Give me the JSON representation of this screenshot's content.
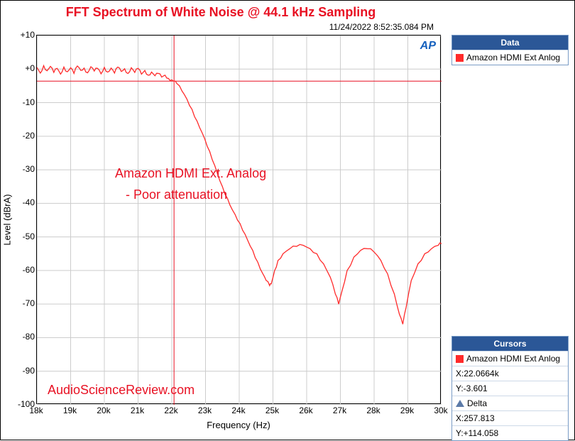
{
  "title": "FFT Spectrum of White Noise @ 44.1 kHz Sampling",
  "timestamp": "11/24/2022 8:52:35.084 PM",
  "logo": "AP",
  "xlabel": "Frequency (Hz)",
  "ylabel": "Level (dBrA)",
  "annotation_line1": "Amazon HDMI Ext. Analog",
  "annotation_line2": "- Poor attenuation",
  "watermark": "AudioScienceReview.com",
  "legend": {
    "header": "Data",
    "series_name": "Amazon HDMI Ext Anlog"
  },
  "cursors": {
    "header": "Cursors",
    "series_name": "Amazon HDMI Ext Anlog",
    "x_label": "X:22.0664k",
    "y_label": "Y:-3.601",
    "delta_label": "Delta",
    "delta_x": "X:257.813",
    "delta_y": "Y:+114.058"
  },
  "chart_data": {
    "type": "line",
    "xlabel": "Frequency (Hz)",
    "ylabel": "Level (dBrA)",
    "xlim": [
      18000,
      30000
    ],
    "ylim": [
      -100,
      10
    ],
    "x_ticks": [
      "18k",
      "19k",
      "20k",
      "21k",
      "22k",
      "23k",
      "24k",
      "25k",
      "26k",
      "27k",
      "28k",
      "29k",
      "30k"
    ],
    "y_ticks": [
      10,
      0,
      -10,
      -20,
      -30,
      -40,
      -50,
      -60,
      -70,
      -80,
      -90,
      -100
    ],
    "cursor": {
      "x": 22066.4,
      "y": -3.601
    },
    "series": [
      {
        "name": "Amazon HDMI Ext Anlog",
        "color": "#ff2b2b",
        "points": [
          [
            18000,
            0.5
          ],
          [
            18100,
            -1.2
          ],
          [
            18200,
            1.0
          ],
          [
            18300,
            -0.5
          ],
          [
            18400,
            0.8
          ],
          [
            18500,
            -1.0
          ],
          [
            18600,
            0.2
          ],
          [
            18700,
            -1.5
          ],
          [
            18800,
            0.6
          ],
          [
            18900,
            -0.8
          ],
          [
            19000,
            0.4
          ],
          [
            19100,
            -1.3
          ],
          [
            19200,
            0.9
          ],
          [
            19300,
            -0.4
          ],
          [
            19400,
            0.3
          ],
          [
            19500,
            -1.1
          ],
          [
            19600,
            0.7
          ],
          [
            19700,
            -0.6
          ],
          [
            19800,
            0.2
          ],
          [
            19900,
            -1.4
          ],
          [
            20000,
            0.5
          ],
          [
            20100,
            -0.9
          ],
          [
            20200,
            0.3
          ],
          [
            20300,
            -1.2
          ],
          [
            20400,
            0.6
          ],
          [
            20500,
            -0.7
          ],
          [
            20600,
            0.1
          ],
          [
            20700,
            -1.3
          ],
          [
            20800,
            0.4
          ],
          [
            20900,
            -1.0
          ],
          [
            21000,
            0.2
          ],
          [
            21100,
            -1.5
          ],
          [
            21200,
            -0.4
          ],
          [
            21300,
            -1.8
          ],
          [
            21400,
            -0.9
          ],
          [
            21500,
            -2.0
          ],
          [
            21600,
            -1.3
          ],
          [
            21700,
            -2.4
          ],
          [
            21800,
            -1.8
          ],
          [
            21900,
            -2.8
          ],
          [
            22000,
            -3.2
          ],
          [
            22066,
            -3.6
          ],
          [
            22150,
            -4.3
          ],
          [
            22300,
            -6.5
          ],
          [
            22450,
            -9.0
          ],
          [
            22600,
            -12.0
          ],
          [
            22750,
            -15.5
          ],
          [
            22900,
            -19.0
          ],
          [
            23050,
            -23.0
          ],
          [
            23200,
            -27.0
          ],
          [
            23350,
            -31.0
          ],
          [
            23500,
            -35.0
          ],
          [
            23650,
            -38.5
          ],
          [
            23800,
            -42.0
          ],
          [
            23950,
            -45.0
          ],
          [
            24100,
            -48.0
          ],
          [
            24250,
            -51.0
          ],
          [
            24400,
            -54.0
          ],
          [
            24550,
            -57.5
          ],
          [
            24700,
            -61.0
          ],
          [
            24800,
            -63.0
          ],
          [
            24900,
            -64.5
          ],
          [
            24950,
            -64.0
          ],
          [
            25050,
            -60.0
          ],
          [
            25150,
            -57.0
          ],
          [
            25300,
            -55.0
          ],
          [
            25500,
            -53.5
          ],
          [
            25700,
            -52.8
          ],
          [
            25900,
            -52.5
          ],
          [
            26100,
            -53.5
          ],
          [
            26300,
            -55.0
          ],
          [
            26500,
            -58.0
          ],
          [
            26700,
            -62.0
          ],
          [
            26850,
            -67.0
          ],
          [
            26950,
            -70.0
          ],
          [
            27050,
            -66.0
          ],
          [
            27200,
            -60.0
          ],
          [
            27400,
            -56.0
          ],
          [
            27600,
            -54.0
          ],
          [
            27800,
            -53.5
          ],
          [
            28000,
            -54.5
          ],
          [
            28200,
            -57.0
          ],
          [
            28400,
            -61.0
          ],
          [
            28600,
            -67.0
          ],
          [
            28750,
            -73.0
          ],
          [
            28850,
            -76.0
          ],
          [
            28950,
            -71.0
          ],
          [
            29100,
            -63.0
          ],
          [
            29300,
            -58.0
          ],
          [
            29500,
            -55.0
          ],
          [
            29700,
            -53.5
          ],
          [
            29900,
            -52.5
          ],
          [
            30000,
            -52.0
          ]
        ]
      }
    ]
  }
}
